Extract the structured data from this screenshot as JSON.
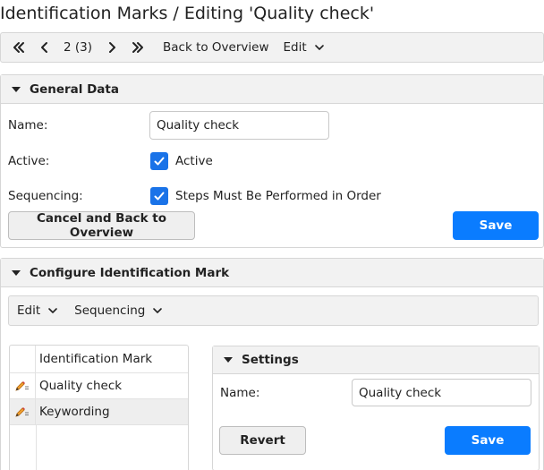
{
  "page": {
    "title": "Identification Marks / Editing 'Quality check'"
  },
  "toolbar": {
    "first_icon": "double-chevron-left-icon",
    "prev_icon": "chevron-left-icon",
    "position": "2 (3)",
    "next_icon": "chevron-right-icon",
    "last_icon": "double-chevron-right-icon",
    "back_label": "Back to Overview",
    "edit_label": "Edit"
  },
  "general": {
    "title": "General Data",
    "name_label": "Name:",
    "name_value": "Quality check",
    "active_label": "Active:",
    "active_checkbox_label": "Active",
    "active_checked": true,
    "sequencing_label": "Sequencing:",
    "sequencing_checkbox_label": "Steps Must Be Performed in Order",
    "sequencing_checked": true,
    "cancel_label": "Cancel and Back to Overview",
    "save_label": "Save"
  },
  "configure": {
    "title": "Configure Identification Mark",
    "edit_label": "Edit",
    "sequencing_menu_label": "Sequencing",
    "list_header": "Identification Mark",
    "items": [
      {
        "label": "Quality check",
        "icon": "pencil-edit-icon"
      },
      {
        "label": "Keywording",
        "icon": "pencil-edit-icon"
      }
    ],
    "settings": {
      "title": "Settings",
      "name_label": "Name:",
      "name_value": "Quality check",
      "revert_label": "Revert",
      "save_label": "Save"
    }
  },
  "colors": {
    "accent": "#0a7cff",
    "checkbox": "#1a73e8",
    "panel_bg": "#f2f2f2",
    "border": "#d6d6d6"
  }
}
